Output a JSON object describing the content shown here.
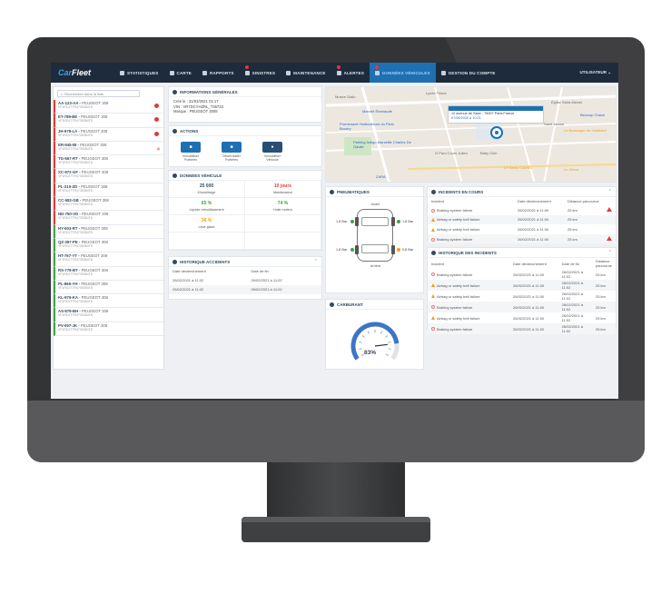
{
  "topnav": {
    "logo_prefix": "Car",
    "logo_suffix": "Fleet",
    "items": [
      {
        "label": "STATISTIQUES"
      },
      {
        "label": "CARTE"
      },
      {
        "label": "RAPPORTS"
      },
      {
        "label": "SINISTRES"
      },
      {
        "label": "MAINTENANCE"
      },
      {
        "label": "ALERTES"
      },
      {
        "label": "DONNÉES VÉHICULES"
      },
      {
        "label": "GESTION DU COMPTE"
      }
    ],
    "user_label": "UTILISATEUR"
  },
  "sidebar": {
    "search_placeholder": "Rechercher dans la liste",
    "vehicles": [
      {
        "plate": "AA-123-AA",
        "model": "PEUGEOT 308",
        "vin": "VF1RDJTTR4735384T8",
        "status": "alert"
      },
      {
        "plate": "ET-789-BE",
        "model": "PEUGEOT 308",
        "vin": "VF1RDJTTR4735384T8",
        "status": "alert"
      },
      {
        "plate": "JH-978-LA",
        "model": "PEUGEOT 308",
        "vin": "VF1RDJTTR4735384T8",
        "status": "alert"
      },
      {
        "plate": "ER-945-IB",
        "model": "PEUGEOT 308",
        "vin": "VF1RDJTTR4735384T8",
        "status": "alert2"
      },
      {
        "plate": "TG-567-RT",
        "model": "PEUGEOT 308",
        "vin": "VF1RDJTTR4735384T8",
        "status": "alert"
      },
      {
        "plate": "XC-972-GF",
        "model": "PEUGEOT 308",
        "vin": "VF1RDJTTR4735384T8",
        "status": "alert"
      },
      {
        "plate": "PL-210-ZD",
        "model": "PEUGEOT 308",
        "vin": "VF1RDJTTR4735384T8",
        "status": "alert"
      },
      {
        "plate": "CC-582-GB",
        "model": "PEUGEOT 308",
        "vin": "VF1RDJTTR4735384T8",
        "status": "alert"
      },
      {
        "plate": "ND-750-VD",
        "model": "PEUGEOT 308",
        "vin": "VF1RDJTTR4735384T8",
        "status": "alert"
      },
      {
        "plate": "HY-603-RT",
        "model": "PEUGEOT 308",
        "vin": "VF1RDJTTR4735384T8",
        "status": "ok"
      },
      {
        "plate": "QZ-357-PE",
        "model": "PEUGEOT 308",
        "vin": "VF1RDJTTR4735384T8",
        "status": "ok"
      },
      {
        "plate": "HT-767-YT",
        "model": "PEUGEOT 308",
        "vin": "VF1RDJTTR4735384T8",
        "status": "ok"
      },
      {
        "plate": "RS-778-BT",
        "model": "PEUGEOT 308",
        "vin": "VF1RDJTTR4735384T8",
        "status": "ok"
      },
      {
        "plate": "PL-865-YH",
        "model": "PEUGEOT 308",
        "vin": "VF1RDJTTR4735384T8",
        "status": "ok"
      },
      {
        "plate": "KL-976-KA",
        "model": "PEUGEOT 308",
        "vin": "VF1RDJTTR4735384T8",
        "status": "ok"
      },
      {
        "plate": "AS-879-BH",
        "model": "PEUGEOT 308",
        "vin": "VF1RDJTTR4735384T8",
        "status": "ok"
      },
      {
        "plate": "PV-097-JK",
        "model": "PEUGEOT 308",
        "vin": "VF1RDJTTR4735384T8",
        "status": "ok"
      }
    ]
  },
  "infos": {
    "title": "INFORMATIONS GÉNÉRALES",
    "line1": "Créé le : 31/03/2021 01:17",
    "line2": "VIN : VR7DCYHZRL_T36733",
    "line3": "Marque : PEUGEOT 3008"
  },
  "actions": {
    "title": "ACTIONS",
    "buttons": [
      {
        "label": "Immobiliser Portières"
      },
      {
        "label": "Déverrouiller Portières"
      },
      {
        "label": "Immobiliser Véhicule"
      }
    ]
  },
  "donnees": {
    "title": "DONNÉES VÉHICULE",
    "cells": [
      {
        "value": "25 000",
        "label": "Kilométrage"
      },
      {
        "value": "10 jours",
        "label": "Maintenance"
      },
      {
        "value": "65 %",
        "label": "Liquide refroidissement"
      },
      {
        "value": "74 %",
        "label": "Huile moteur"
      },
      {
        "value": "36 %",
        "label": "Lave-glace"
      },
      {
        "value": "",
        "label": ""
      },
      {
        "value": "",
        "label": ""
      },
      {
        "value": "",
        "label": ""
      }
    ]
  },
  "historique_acc": {
    "title": "HISTORIQUE ACCIDENTS",
    "headers": [
      "Date déclenchement",
      "Date de fin"
    ],
    "rows": [
      [
        "26/02/2021 à 11:02",
        "26/02/2021 à 11:02"
      ],
      [
        "26/02/2021 à 11:02",
        "26/02/2021 à 11:02"
      ]
    ]
  },
  "pneus": {
    "title": "PNEUMATIQUES",
    "front_label": "Avant",
    "rear_label": "Arrière",
    "fl": "1,8 Bar",
    "fr": "1,8 Bar",
    "rl": "1,8 Bar",
    "rr": "0,8 Bar"
  },
  "carburant": {
    "title": "CARBURANT",
    "value": "83%",
    "level": 0.83
  },
  "map": {
    "popup_line1": "12 avenue de Saxe - 75007 Paris France",
    "popup_line2": "07/06/2020 à 10:21",
    "labels": [
      {
        "text": "Lycée Thiers"
      },
      {
        "text": "Musée Gallo"
      },
      {
        "text": "Église Saint-Michel"
      },
      {
        "text": "Biocoop Chave"
      },
      {
        "text": "Marché Émeraude"
      },
      {
        "text": "Promenade Horticulteurs du Plein Bouéry"
      },
      {
        "text": "Parking Indigo Marseille Charles De Gaulle"
      },
      {
        "text": "O Parc Cours Julien"
      },
      {
        "text": "Baby Club"
      },
      {
        "text": "Le Boulanger de Garibaldi"
      },
      {
        "text": "Le Santo Cachito"
      },
      {
        "text": "Le Zebra"
      },
      {
        "text": "Saint Jaume"
      },
      {
        "text": "ZARA"
      }
    ]
  },
  "incidents_cours": {
    "title": "INCIDENTS EN COURS",
    "headers": [
      "Incident",
      "Date déclenchement",
      "Distance parcourue"
    ],
    "rows": [
      {
        "icon": "circle",
        "incident": "Braking system failure",
        "date": "26/02/2021 à 11:00",
        "distance": "25 km",
        "flag": true
      },
      {
        "icon": "warn",
        "incident": "Airbag or safety belt failure",
        "date": "26/02/2021 à 11:00",
        "distance": "25 km",
        "flag": false
      },
      {
        "icon": "warn",
        "incident": "Airbag or safety belt failure",
        "date": "26/02/2021 à 11:00",
        "distance": "25 km",
        "flag": false
      },
      {
        "icon": "circle",
        "incident": "Braking system failure",
        "date": "26/02/2021 à 11:00",
        "distance": "25 km",
        "flag": true
      }
    ]
  },
  "historique_inc": {
    "title": "HISTORIQUE DES INCIDENTS",
    "headers": [
      "Incident",
      "Date déclenchement",
      "Date de fin",
      "Distance parcourue"
    ],
    "rows": [
      {
        "icon": "circle",
        "incident": "Braking system failure",
        "start": "26/02/2021 à 11:00",
        "end": "26/02/2021 à 11:02",
        "distance": "25 km"
      },
      {
        "icon": "warn",
        "incident": "Airbag or safety belt failure",
        "start": "26/02/2021 à 11:00",
        "end": "26/02/2021 à 11:02",
        "distance": "25 km"
      },
      {
        "icon": "warn",
        "incident": "Airbag or safety belt failure",
        "start": "26/02/2021 à 11:00",
        "end": "26/02/2021 à 11:02",
        "distance": "25 km"
      },
      {
        "icon": "circle",
        "incident": "Braking system failure",
        "start": "26/02/2021 à 11:00",
        "end": "26/02/2021 à 11:02",
        "distance": "25 km"
      },
      {
        "icon": "warn",
        "incident": "Airbag or safety belt failure",
        "start": "26/02/2021 à 11:00",
        "end": "26/02/2021 à 11:02",
        "distance": "25 km"
      },
      {
        "icon": "circle",
        "incident": "Braking system failure",
        "start": "26/02/2021 à 11:00",
        "end": "26/02/2021 à 11:02",
        "distance": "25 km"
      }
    ]
  },
  "colors": {
    "nav_bg": "#1d2b3c",
    "accent": "#1f6fb3",
    "alert": "#e53935",
    "ok": "#43a047",
    "warn": "#f59d17"
  }
}
